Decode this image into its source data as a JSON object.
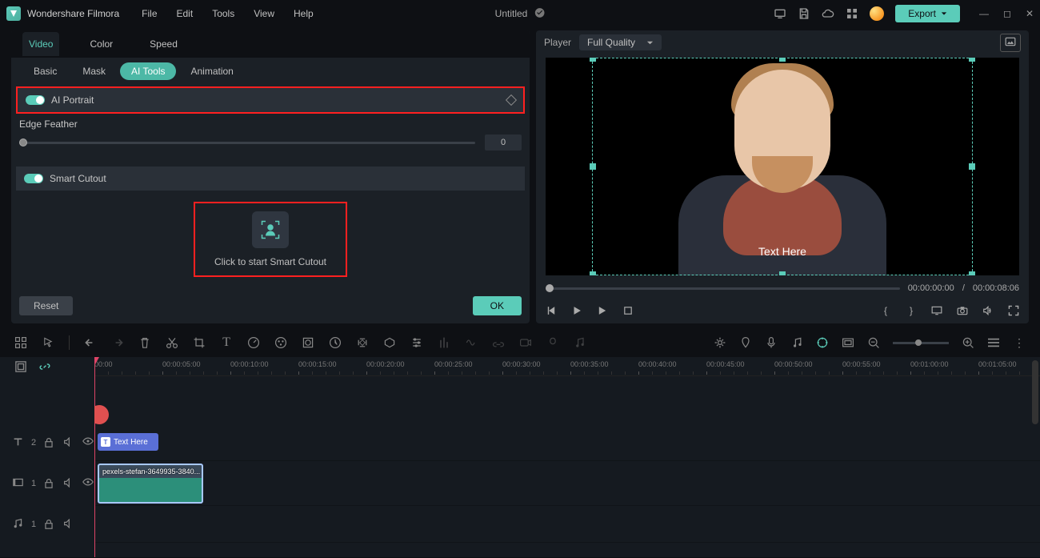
{
  "app": {
    "name": "Wondershare Filmora",
    "document": "Untitled"
  },
  "menubar": [
    "File",
    "Edit",
    "Tools",
    "View",
    "Help"
  ],
  "export_label": "Export",
  "panel": {
    "tabs": [
      "Video",
      "Color",
      "Speed"
    ],
    "active_tab": "Video",
    "subtabs": [
      "Basic",
      "Mask",
      "AI Tools",
      "Animation"
    ],
    "active_subtab": "AI Tools",
    "ai_portrait": {
      "label": "AI Portrait",
      "on": true
    },
    "edge_feather": {
      "label": "Edge Feather",
      "value": "0"
    },
    "smart_cutout": {
      "label": "Smart Cutout",
      "on": true,
      "hint": "Click to start Smart Cutout"
    },
    "reset": "Reset",
    "ok": "OK"
  },
  "player": {
    "label": "Player",
    "quality": "Full Quality",
    "text_overlay": "Text Here",
    "current": "00:00:00:00",
    "separator": "/",
    "duration": "00:00:08:06"
  },
  "ruler_ticks": [
    "00:00",
    "00:00:05:00",
    "00:00:10:00",
    "00:00:15:00",
    "00:00:20:00",
    "00:00:25:00",
    "00:00:30:00",
    "00:00:35:00",
    "00:00:40:00",
    "00:00:45:00",
    "00:00:50:00",
    "00:00:55:00",
    "00:01:00:00",
    "00:01:05:00"
  ],
  "tracks": {
    "text": {
      "num": "2",
      "clip_label": "Text Here"
    },
    "video": {
      "num": "1",
      "clip_label": "pexels-stefan-3649935-3840..."
    },
    "audio": {
      "num": "1"
    }
  }
}
